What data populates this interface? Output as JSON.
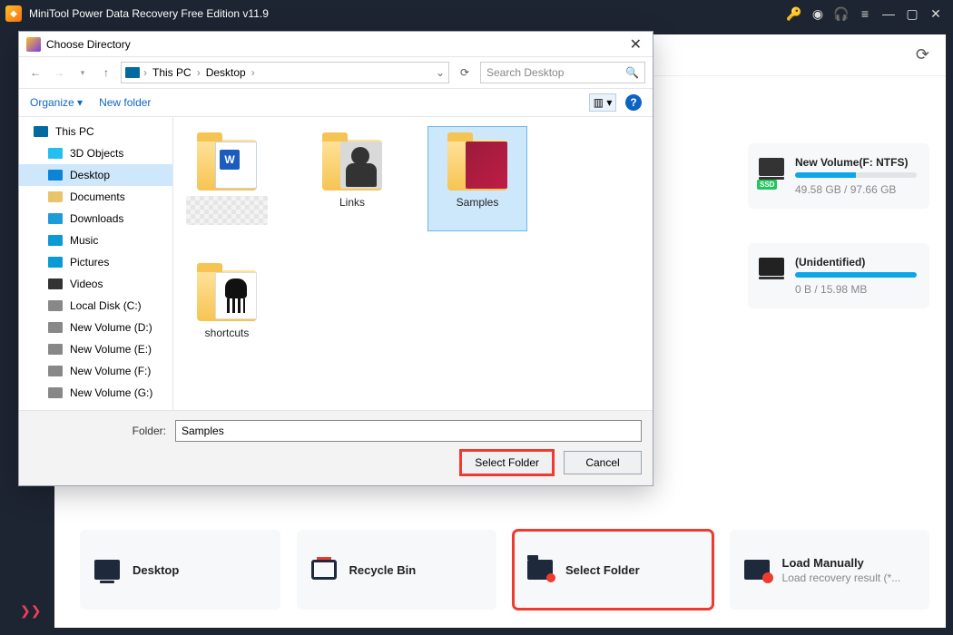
{
  "app": {
    "title": "MiniTool Power Data Recovery Free Edition v11.9"
  },
  "volumes": [
    {
      "name": "New Volume(F: NTFS)",
      "used": "49.58 GB",
      "total": "97.66 GB",
      "ssd": "SSD"
    },
    {
      "name": "(Unidentified)",
      "used": "0 B",
      "total": "15.98 MB"
    }
  ],
  "bottom": {
    "desktop": "Desktop",
    "recycle": "Recycle Bin",
    "select_folder": "Select Folder",
    "load_title": "Load Manually",
    "load_sub": "Load recovery result (*..."
  },
  "dialog": {
    "title": "Choose Directory",
    "breadcrumbs": [
      "This PC",
      "Desktop"
    ],
    "search_placeholder": "Search Desktop",
    "organize": "Organize",
    "new_folder": "New folder",
    "help": "?",
    "tree": [
      {
        "label": "This PC",
        "iconCls": "pc",
        "lvl": 1
      },
      {
        "label": "3D Objects",
        "iconCls": "cube",
        "lvl": 2
      },
      {
        "label": "Desktop",
        "iconCls": "desk",
        "lvl": 2,
        "selected": true
      },
      {
        "label": "Documents",
        "iconCls": "doc",
        "lvl": 2
      },
      {
        "label": "Downloads",
        "iconCls": "dl",
        "lvl": 2
      },
      {
        "label": "Music",
        "iconCls": "mus",
        "lvl": 2
      },
      {
        "label": "Pictures",
        "iconCls": "pic",
        "lvl": 2
      },
      {
        "label": "Videos",
        "iconCls": "vid",
        "lvl": 2
      },
      {
        "label": "Local Disk (C:)",
        "iconCls": "drv",
        "lvl": 2
      },
      {
        "label": "New Volume (D:)",
        "iconCls": "drv",
        "lvl": 2
      },
      {
        "label": "New Volume (E:)",
        "iconCls": "drv",
        "lvl": 2
      },
      {
        "label": "New Volume (F:)",
        "iconCls": "drv",
        "lvl": 2
      },
      {
        "label": "New Volume (G:)",
        "iconCls": "drv",
        "lvl": 2
      }
    ],
    "items": [
      {
        "label": "",
        "ov": "word",
        "pixelated": true
      },
      {
        "label": "Links",
        "ov": "person"
      },
      {
        "label": "Samples",
        "ov": "indd",
        "selected": true
      },
      {
        "label": "shortcuts",
        "ov": "skull"
      }
    ],
    "folder_label": "Folder:",
    "folder_value": "Samples",
    "select_btn": "Select Folder",
    "cancel_btn": "Cancel"
  }
}
